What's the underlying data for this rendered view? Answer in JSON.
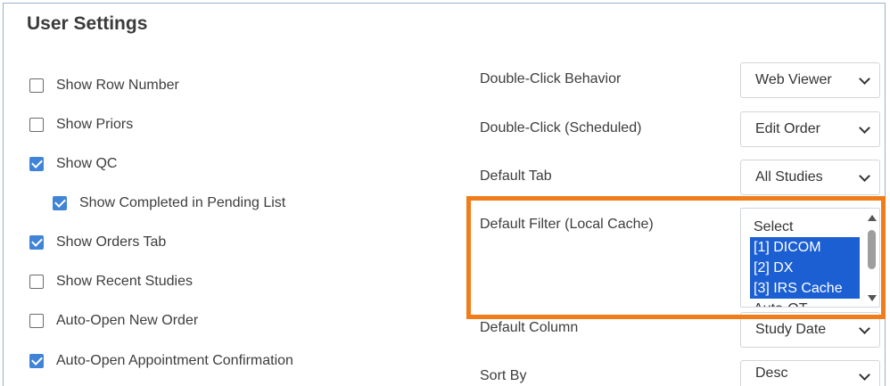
{
  "title": "User Settings",
  "checkboxes": [
    {
      "label": "Show Row Number",
      "checked": false
    },
    {
      "label": "Show Priors",
      "checked": false
    },
    {
      "label": "Show QC",
      "checked": true
    },
    {
      "label": "Show Completed in Pending List",
      "checked": true
    },
    {
      "label": "Show Orders Tab",
      "checked": true
    },
    {
      "label": "Show Recent Studies",
      "checked": false
    },
    {
      "label": "Auto-Open New Order",
      "checked": false
    },
    {
      "label": "Auto-Open Appointment Confirmation",
      "checked": true
    }
  ],
  "fields": {
    "double_click_behavior": {
      "label": "Double-Click Behavior",
      "value": "Web Viewer"
    },
    "double_click_scheduled": {
      "label": "Double-Click (Scheduled)",
      "value": "Edit Order"
    },
    "default_tab": {
      "label": "Default Tab",
      "value": "All Studies"
    },
    "default_filter": {
      "label": "Default Filter (Local Cache)",
      "options": [
        {
          "text": "Select",
          "selected": false
        },
        {
          "text": "[1] DICOM",
          "selected": true
        },
        {
          "text": "[2] DX",
          "selected": true
        },
        {
          "text": "[3] IRS Cache",
          "selected": true
        },
        {
          "text": "Auto-QT",
          "selected": false
        }
      ]
    },
    "default_column": {
      "label": "Default Column",
      "value": "Study Date"
    },
    "sort_by": {
      "label": "Sort By",
      "value": "Desc"
    }
  },
  "colors": {
    "highlight": "#f07d19",
    "selection": "#1c5fd3",
    "checkbox": "#3f84d6"
  }
}
